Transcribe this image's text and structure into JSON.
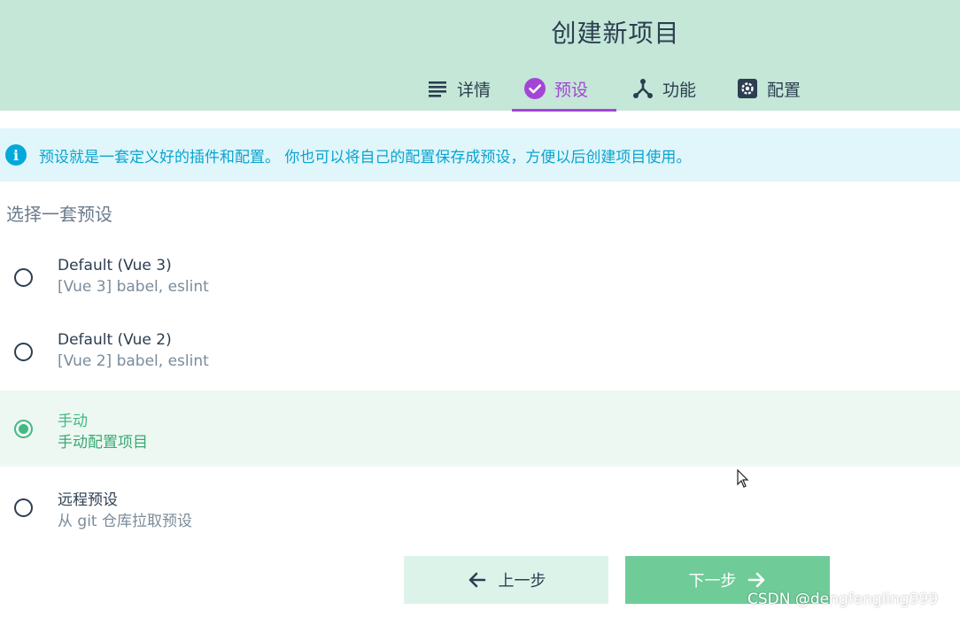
{
  "header": {
    "title": "创建新项目",
    "tabs": [
      {
        "label": "详情",
        "icon": "list-icon"
      },
      {
        "label": "预设",
        "icon": "check-circle-icon",
        "active": true
      },
      {
        "label": "功能",
        "icon": "fork-icon"
      },
      {
        "label": "配置",
        "icon": "settings-icon"
      }
    ]
  },
  "info": {
    "text": "预设就是一套定义好的插件和配置。 你也可以将自己的配置保存成预设，方便以后创建项目使用。"
  },
  "presets": {
    "section_title": "选择一套预设",
    "options": [
      {
        "name": "Default (Vue 3)",
        "desc": "[Vue 3] babel, eslint",
        "selected": false
      },
      {
        "name": "Default (Vue 2)",
        "desc": "[Vue 2] babel, eslint",
        "selected": false
      },
      {
        "name": "手动",
        "desc": "手动配置项目",
        "selected": true
      },
      {
        "name": "远程预设",
        "desc": "从 git 仓库拉取预设",
        "selected": false
      }
    ]
  },
  "footer": {
    "prev_label": "上一步",
    "next_label": "下一步"
  },
  "watermark": "CSDN @dengfengling999",
  "colors": {
    "header_bg": "#c4e7d8",
    "accent": "#a445d6",
    "selected": "#42b983",
    "info": "#03a9d8"
  }
}
